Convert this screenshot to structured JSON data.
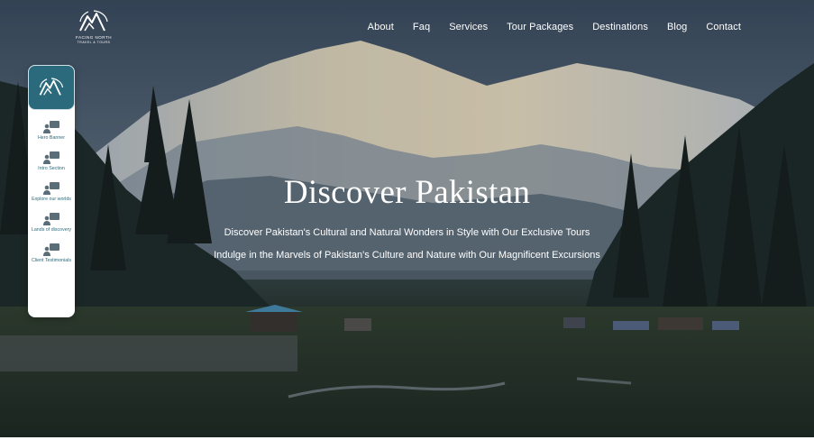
{
  "brand": {
    "logo_name": "FACING NORTH",
    "logo_tagline": "TRAVEL & TOURS"
  },
  "nav": {
    "items": [
      "About",
      "Faq",
      "Services",
      "Tour Packages",
      "Destinations",
      "Blog",
      "Contact"
    ]
  },
  "sidenav": {
    "items": [
      {
        "label": "Hero Banner",
        "icon": "presenter-icon"
      },
      {
        "label": "Intro Section",
        "icon": "presenter-icon"
      },
      {
        "label": "Explore our worlds",
        "icon": "presenter-icon"
      },
      {
        "label": "Lands of discovery",
        "icon": "presenter-icon"
      },
      {
        "label": "Client Testimonials",
        "icon": "presenter-icon"
      }
    ]
  },
  "hero": {
    "title": "Discover Pakistan",
    "subtitle1": "Discover Pakistan's Cultural and Natural Wonders in Style with Our Exclusive Tours",
    "subtitle2": "Indulge in the Marvels of Pakistan's Culture and Nature with Our Magnificent Excursions"
  },
  "colors": {
    "accent": "#2b6a7c",
    "text": "#ffffff"
  }
}
